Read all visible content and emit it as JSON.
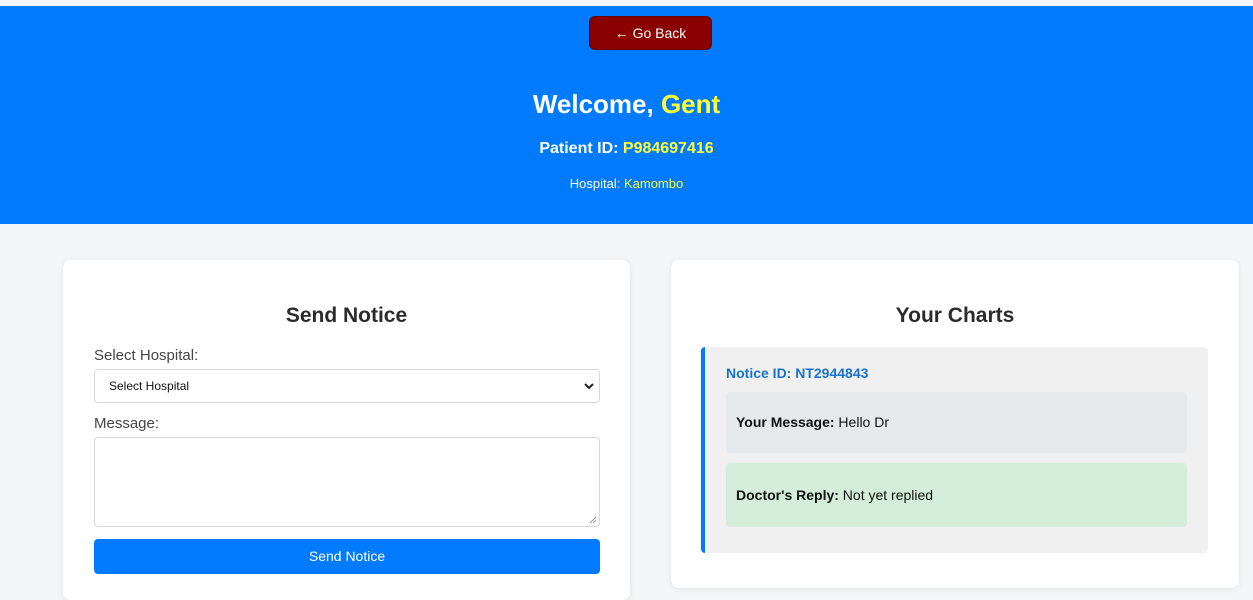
{
  "header": {
    "back_label": "← Go Back",
    "welcome_prefix": "Welcome, ",
    "user_name": "Gent",
    "patient_id_label": "Patient ID: ",
    "patient_id": "P984697416",
    "hospital_label": "Hospital: ",
    "hospital_name": "Kamombo"
  },
  "send_notice": {
    "title": "Send Notice",
    "hospital_label": "Select Hospital:",
    "hospital_select_value": "Select Hospital",
    "message_label": "Message:",
    "message_value": "",
    "send_label": "Send Notice"
  },
  "charts": {
    "title": "Your Charts",
    "notices": [
      {
        "id_label": "Notice ID: NT2944843",
        "message_label": "Your Message:",
        "message": " Hello Dr",
        "reply_label": "Doctor's Reply:",
        "reply": " Not yet replied"
      }
    ]
  },
  "colors": {
    "header_bg": "#007bff",
    "highlight": "#ffff33",
    "back_button": "#8b0000",
    "reply_bg": "#d4edda"
  }
}
